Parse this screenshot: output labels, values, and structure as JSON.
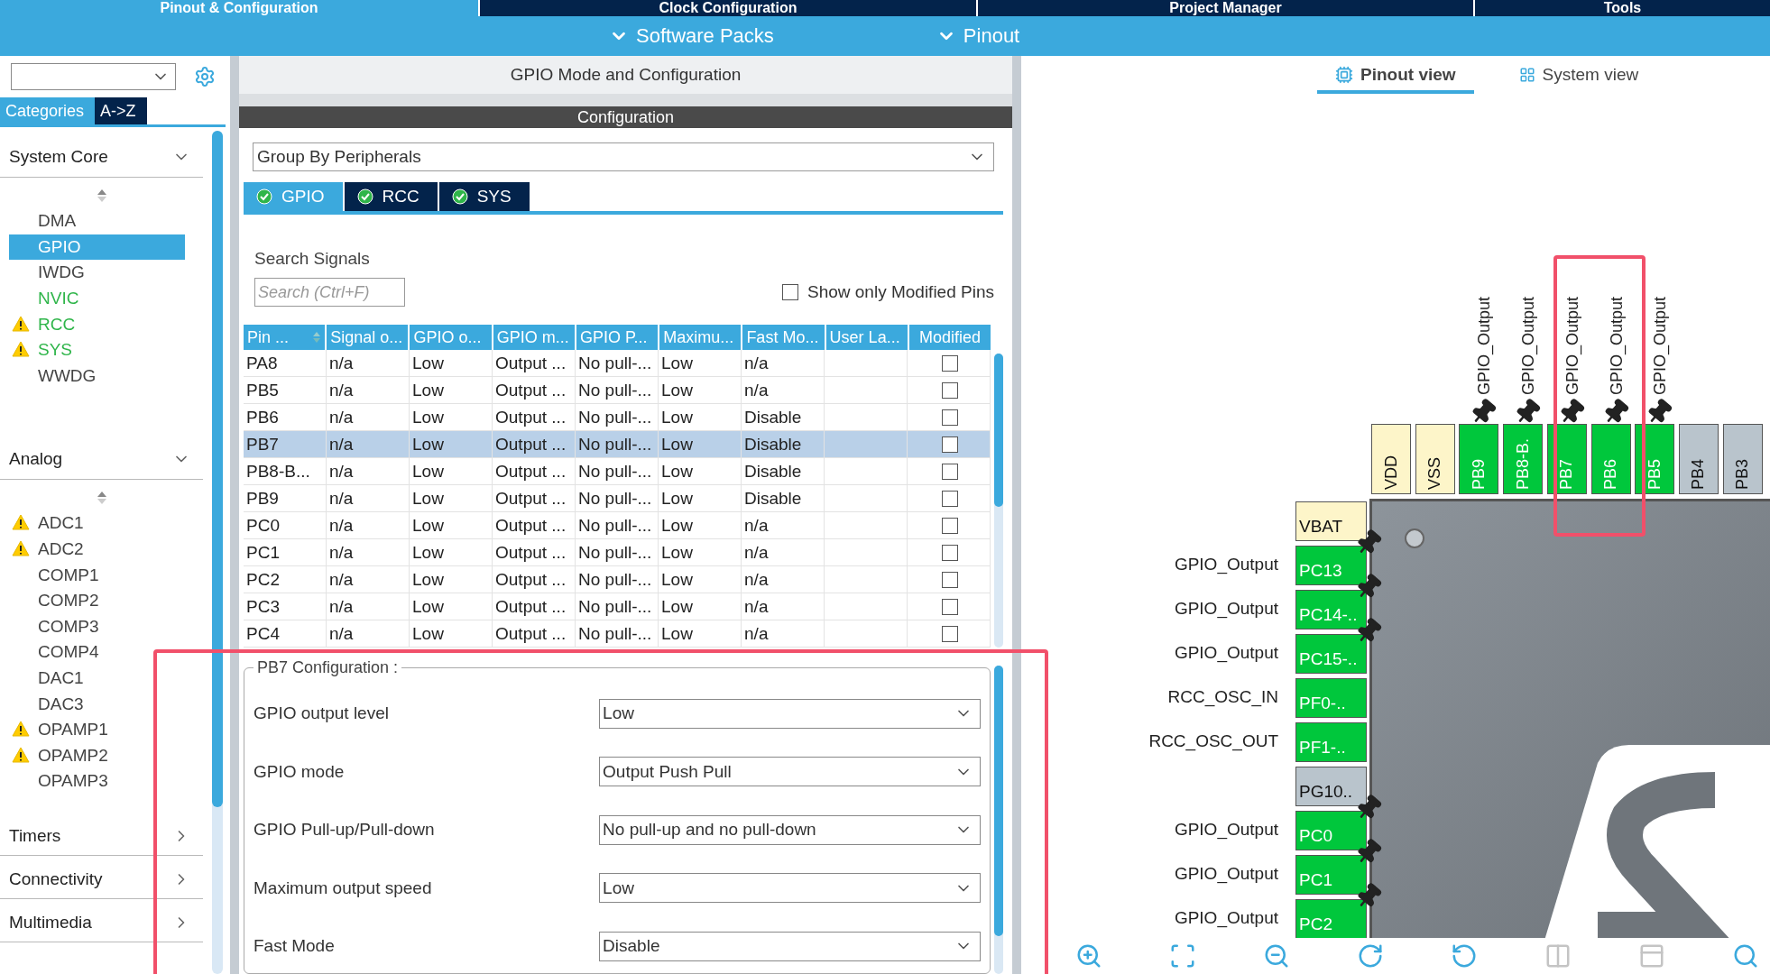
{
  "top_tabs": [
    {
      "label": "Pinout & Configuration",
      "selected": true
    },
    {
      "label": "Clock Configuration",
      "selected": false
    },
    {
      "label": "Project Manager",
      "selected": false
    },
    {
      "label": "Tools",
      "selected": false
    }
  ],
  "sub_menu": [
    "Software Packs",
    "Pinout"
  ],
  "sidebar": {
    "tabs": [
      {
        "label": "Categories",
        "selected": true
      },
      {
        "label": "A->Z",
        "selected": false
      }
    ],
    "groups": [
      {
        "label": "System Core",
        "expanded": true,
        "items": [
          {
            "label": "DMA",
            "selected": false,
            "configured": false,
            "warning": false
          },
          {
            "label": "GPIO",
            "selected": true,
            "configured": false,
            "warning": false
          },
          {
            "label": "IWDG",
            "selected": false,
            "configured": false,
            "warning": false
          },
          {
            "label": "NVIC",
            "selected": false,
            "configured": true,
            "warning": false
          },
          {
            "label": "RCC",
            "selected": false,
            "configured": true,
            "warning": true
          },
          {
            "label": "SYS",
            "selected": false,
            "configured": true,
            "warning": true
          },
          {
            "label": "WWDG",
            "selected": false,
            "configured": false,
            "warning": false
          }
        ]
      },
      {
        "label": "Analog",
        "expanded": true,
        "items": [
          {
            "label": "ADC1",
            "selected": false,
            "configured": false,
            "warning": true
          },
          {
            "label": "ADC2",
            "selected": false,
            "configured": false,
            "warning": true
          },
          {
            "label": "COMP1",
            "selected": false,
            "configured": false,
            "warning": false
          },
          {
            "label": "COMP2",
            "selected": false,
            "configured": false,
            "warning": false
          },
          {
            "label": "COMP3",
            "selected": false,
            "configured": false,
            "warning": false
          },
          {
            "label": "COMP4",
            "selected": false,
            "configured": false,
            "warning": false
          },
          {
            "label": "DAC1",
            "selected": false,
            "configured": false,
            "warning": false
          },
          {
            "label": "DAC3",
            "selected": false,
            "configured": false,
            "warning": false
          },
          {
            "label": "OPAMP1",
            "selected": false,
            "configured": false,
            "warning": true
          },
          {
            "label": "OPAMP2",
            "selected": false,
            "configured": false,
            "warning": true
          },
          {
            "label": "OPAMP3",
            "selected": false,
            "configured": false,
            "warning": false
          }
        ]
      },
      {
        "label": "Timers",
        "expanded": false
      },
      {
        "label": "Connectivity",
        "expanded": false
      },
      {
        "label": "Multimedia",
        "expanded": false
      }
    ]
  },
  "config_panel": {
    "title": "GPIO Mode and Configuration",
    "header": "Configuration",
    "group_by": "Group By Peripherals",
    "tabs": [
      {
        "label": "GPIO",
        "selected": true,
        "ok": true
      },
      {
        "label": "RCC",
        "selected": false,
        "ok": true
      },
      {
        "label": "SYS",
        "selected": false,
        "ok": true
      }
    ],
    "search": {
      "label": "Search Signals",
      "placeholder": "Search (Ctrl+F)"
    },
    "show_modified": {
      "label": "Show only Modified Pins",
      "checked": false
    },
    "table": {
      "columns": [
        "Pin ...",
        "Signal o...",
        "GPIO o...",
        "GPIO m...",
        "GPIO P...",
        "Maximu...",
        "Fast Mo...",
        "User La...",
        "Modified"
      ],
      "rows": [
        {
          "cells": [
            "PA8",
            "n/a",
            "Low",
            "Output ...",
            "No pull-...",
            "Low",
            "n/a"
          ],
          "modified": false,
          "selected": false
        },
        {
          "cells": [
            "PB5",
            "n/a",
            "Low",
            "Output ...",
            "No pull-...",
            "Low",
            "n/a"
          ],
          "modified": false,
          "selected": false
        },
        {
          "cells": [
            "PB6",
            "n/a",
            "Low",
            "Output ...",
            "No pull-...",
            "Low",
            "Disable"
          ],
          "modified": false,
          "selected": false
        },
        {
          "cells": [
            "PB7",
            "n/a",
            "Low",
            "Output ...",
            "No pull-...",
            "Low",
            "Disable"
          ],
          "modified": false,
          "selected": true
        },
        {
          "cells": [
            "PB8-B...",
            "n/a",
            "Low",
            "Output ...",
            "No pull-...",
            "Low",
            "Disable"
          ],
          "modified": false,
          "selected": false
        },
        {
          "cells": [
            "PB9",
            "n/a",
            "Low",
            "Output ...",
            "No pull-...",
            "Low",
            "Disable"
          ],
          "modified": false,
          "selected": false
        },
        {
          "cells": [
            "PC0",
            "n/a",
            "Low",
            "Output ...",
            "No pull-...",
            "Low",
            "n/a"
          ],
          "modified": false,
          "selected": false
        },
        {
          "cells": [
            "PC1",
            "n/a",
            "Low",
            "Output ...",
            "No pull-...",
            "Low",
            "n/a"
          ],
          "modified": false,
          "selected": false
        },
        {
          "cells": [
            "PC2",
            "n/a",
            "Low",
            "Output ...",
            "No pull-...",
            "Low",
            "n/a"
          ],
          "modified": false,
          "selected": false
        },
        {
          "cells": [
            "PC3",
            "n/a",
            "Low",
            "Output ...",
            "No pull-...",
            "Low",
            "n/a"
          ],
          "modified": false,
          "selected": false
        },
        {
          "cells": [
            "PC4",
            "n/a",
            "Low",
            "Output ...",
            "No pull-...",
            "Low",
            "n/a"
          ],
          "modified": false,
          "selected": false
        }
      ]
    },
    "pin_config": {
      "title": "PB7 Configuration :",
      "fields": [
        {
          "label": "GPIO output level",
          "value": "Low"
        },
        {
          "label": "GPIO mode",
          "value": "Output Push Pull"
        },
        {
          "label": "GPIO Pull-up/Pull-down",
          "value": "No pull-up and no pull-down"
        },
        {
          "label": "Maximum output speed",
          "value": "Low"
        },
        {
          "label": "Fast Mode",
          "value": "Disable"
        }
      ]
    }
  },
  "pinout": {
    "view_tabs": [
      {
        "label": "Pinout view",
        "selected": true
      },
      {
        "label": "System view",
        "selected": false
      }
    ],
    "top_pins": [
      {
        "name": "VDD",
        "kind": "power"
      },
      {
        "name": "VSS",
        "kind": "power"
      },
      {
        "name": "PB9",
        "kind": "gpio",
        "signal": "GPIO_Output",
        "pinned": true
      },
      {
        "name": "PB8-B.",
        "kind": "gpio",
        "signal": "GPIO_Output",
        "pinned": true
      },
      {
        "name": "PB7",
        "kind": "gpio",
        "signal": "GPIO_Output",
        "pinned": true
      },
      {
        "name": "PB6",
        "kind": "gpio",
        "signal": "GPIO_Output",
        "pinned": true
      },
      {
        "name": "PB5",
        "kind": "gpio",
        "signal": "GPIO_Output",
        "pinned": true
      },
      {
        "name": "PB4",
        "kind": "free"
      },
      {
        "name": "PB3",
        "kind": "free"
      }
    ],
    "left_pins": [
      {
        "name": "VBAT",
        "kind": "power"
      },
      {
        "name": "PC13",
        "kind": "gpio",
        "signal": "GPIO_Output",
        "pinned": true
      },
      {
        "name": "PC14-..",
        "kind": "gpio",
        "signal": "GPIO_Output",
        "pinned": true
      },
      {
        "name": "PC15-..",
        "kind": "gpio",
        "signal": "GPIO_Output",
        "pinned": true
      },
      {
        "name": "PF0-..",
        "kind": "gpio",
        "signal": "RCC_OSC_IN",
        "pinned": false
      },
      {
        "name": "PF1-..",
        "kind": "gpio",
        "signal": "RCC_OSC_OUT",
        "pinned": false
      },
      {
        "name": "PG10..",
        "kind": "free"
      },
      {
        "name": "PC0",
        "kind": "gpio",
        "signal": "GPIO_Output",
        "pinned": true
      },
      {
        "name": "PC1",
        "kind": "gpio",
        "signal": "GPIO_Output",
        "pinned": true
      },
      {
        "name": "PC2",
        "kind": "gpio",
        "signal": "GPIO_Output",
        "pinned": true
      }
    ],
    "toolbar": [
      {
        "kind": "zoom_in",
        "disabled": false
      },
      {
        "kind": "fit",
        "disabled": false
      },
      {
        "kind": "zoom_out",
        "disabled": false
      },
      {
        "kind": "rotate_right",
        "disabled": false
      },
      {
        "kind": "rotate_left",
        "disabled": false
      },
      {
        "kind": "split",
        "disabled": true
      },
      {
        "kind": "layout",
        "disabled": true
      },
      {
        "kind": "search",
        "disabled": false
      }
    ]
  }
}
